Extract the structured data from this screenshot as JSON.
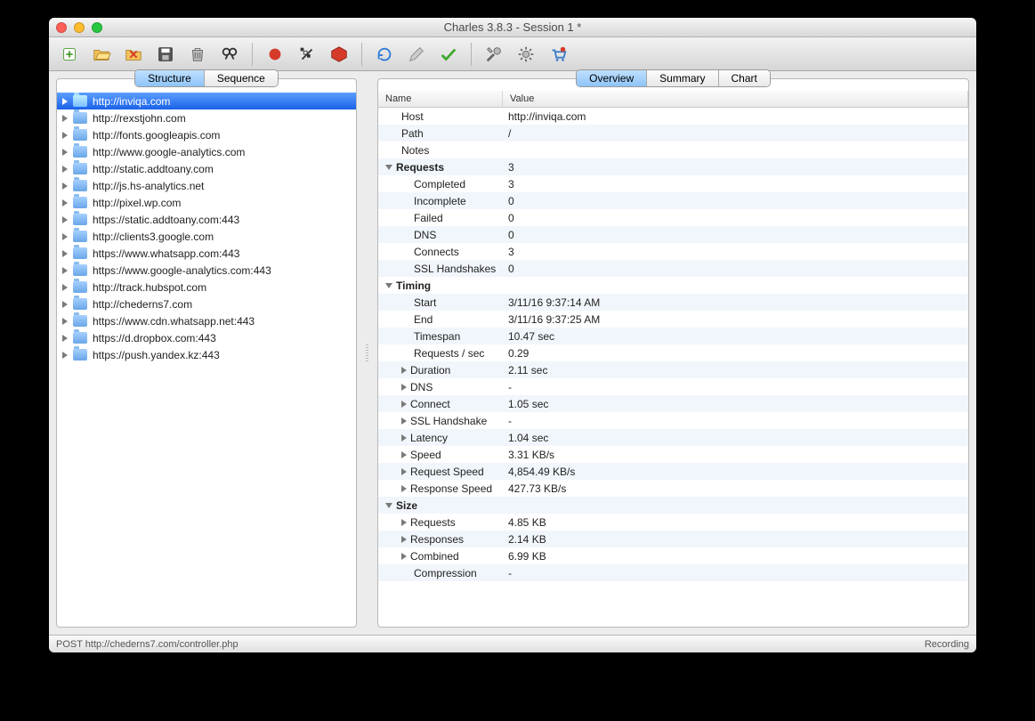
{
  "window": {
    "title": "Charles 3.8.3 - Session 1 *"
  },
  "left": {
    "tabs": [
      {
        "label": "Structure",
        "active": true
      },
      {
        "label": "Sequence",
        "active": false
      }
    ],
    "hosts": [
      {
        "label": "http://inviqa.com",
        "selected": true
      },
      {
        "label": "http://rexstjohn.com"
      },
      {
        "label": "http://fonts.googleapis.com"
      },
      {
        "label": "http://www.google-analytics.com"
      },
      {
        "label": "http://static.addtoany.com"
      },
      {
        "label": "http://js.hs-analytics.net"
      },
      {
        "label": "http://pixel.wp.com"
      },
      {
        "label": "https://static.addtoany.com:443"
      },
      {
        "label": "http://clients3.google.com"
      },
      {
        "label": "https://www.whatsapp.com:443"
      },
      {
        "label": "https://www.google-analytics.com:443"
      },
      {
        "label": "http://track.hubspot.com"
      },
      {
        "label": "http://chederns7.com"
      },
      {
        "label": "https://www.cdn.whatsapp.net:443"
      },
      {
        "label": "https://d.dropbox.com:443"
      },
      {
        "label": "https://push.yandex.kz:443"
      }
    ]
  },
  "right": {
    "tabs": [
      {
        "label": "Overview",
        "active": true
      },
      {
        "label": "Summary",
        "active": false
      },
      {
        "label": "Chart",
        "active": false
      }
    ],
    "columns": {
      "name": "Name",
      "value": "Value"
    },
    "rows": [
      {
        "level": 1,
        "name": "Host",
        "value": "http://inviqa.com"
      },
      {
        "level": 1,
        "name": "Path",
        "value": "/"
      },
      {
        "level": 1,
        "name": "Notes",
        "value": ""
      },
      {
        "level": 0,
        "exp": "open",
        "name": "Requests",
        "value": "3"
      },
      {
        "level": 2,
        "name": "Completed",
        "value": "3"
      },
      {
        "level": 2,
        "name": "Incomplete",
        "value": "0"
      },
      {
        "level": 2,
        "name": "Failed",
        "value": "0"
      },
      {
        "level": 2,
        "name": "DNS",
        "value": "0"
      },
      {
        "level": 2,
        "name": "Connects",
        "value": "3"
      },
      {
        "level": 2,
        "name": "SSL Handshakes",
        "value": "0"
      },
      {
        "level": 0,
        "exp": "open",
        "name": "Timing",
        "value": ""
      },
      {
        "level": 2,
        "name": "Start",
        "value": "3/11/16 9:37:14 AM"
      },
      {
        "level": 2,
        "name": "End",
        "value": "3/11/16 9:37:25 AM"
      },
      {
        "level": 2,
        "name": "Timespan",
        "value": "10.47 sec"
      },
      {
        "level": 2,
        "name": "Requests / sec",
        "value": "0.29"
      },
      {
        "level": 1,
        "exp": "closed",
        "name": "Duration",
        "value": "2.11 sec"
      },
      {
        "level": 1,
        "exp": "closed",
        "name": "DNS",
        "value": "-"
      },
      {
        "level": 1,
        "exp": "closed",
        "name": "Connect",
        "value": "1.05 sec"
      },
      {
        "level": 1,
        "exp": "closed",
        "name": "SSL Handshake",
        "value": "-"
      },
      {
        "level": 1,
        "exp": "closed",
        "name": "Latency",
        "value": "1.04 sec"
      },
      {
        "level": 1,
        "exp": "closed",
        "name": "Speed",
        "value": "3.31 KB/s"
      },
      {
        "level": 1,
        "exp": "closed",
        "name": "Request Speed",
        "value": "4,854.49 KB/s"
      },
      {
        "level": 1,
        "exp": "closed",
        "name": "Response Speed",
        "value": "427.73 KB/s"
      },
      {
        "level": 0,
        "exp": "open",
        "name": "Size",
        "value": ""
      },
      {
        "level": 1,
        "exp": "closed",
        "name": "Requests",
        "value": "4.85 KB"
      },
      {
        "level": 1,
        "exp": "closed",
        "name": "Responses",
        "value": "2.14 KB"
      },
      {
        "level": 1,
        "exp": "closed",
        "name": "Combined",
        "value": "6.99 KB"
      },
      {
        "level": 2,
        "name": "Compression",
        "value": "-"
      }
    ]
  },
  "status": {
    "left": "POST http://chederns7.com/controller.php",
    "right": "Recording"
  }
}
